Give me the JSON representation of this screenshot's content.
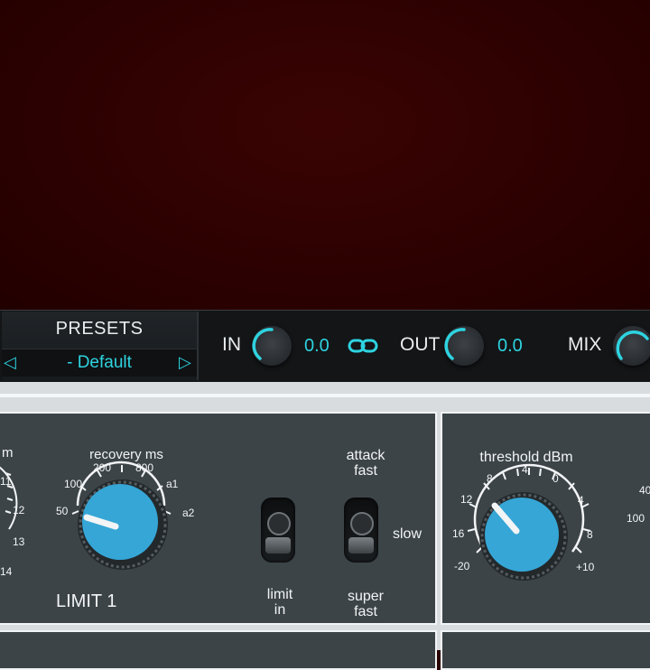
{
  "presets": {
    "title": "PRESETS",
    "current": "- Default",
    "prev_icon": "◁",
    "next_icon": "▷"
  },
  "io": {
    "in_label": "IN",
    "in_value": "0.0",
    "out_label": "OUT",
    "out_value": "0.0",
    "mix_label": "MIX"
  },
  "limit_panel": {
    "left_unit_fragment": "m",
    "left_scale": [
      "11",
      "12",
      "13",
      "14"
    ],
    "recovery_title": "recovery ms",
    "recovery_scale": [
      "50",
      "100",
      "200",
      "800",
      "a1",
      "a2"
    ],
    "name": "LIMIT 1",
    "limit_in_label_1": "limit",
    "limit_in_label_2": "in",
    "attack_top_1": "attack",
    "attack_top_2": "fast",
    "attack_side": "slow",
    "attack_bottom_1": "super",
    "attack_bottom_2": "fast"
  },
  "threshold_panel": {
    "title": "threshold dBm",
    "scale": [
      "-20",
      "16",
      "12",
      "8",
      "4",
      "0",
      "4",
      "8",
      "+10"
    ],
    "right_fragment_top": "40",
    "right_fragment_bottom": "100"
  },
  "colors": {
    "accent": "#2ed3e0",
    "knob_blue": "#35a6d6",
    "panel": "#3c4448"
  }
}
